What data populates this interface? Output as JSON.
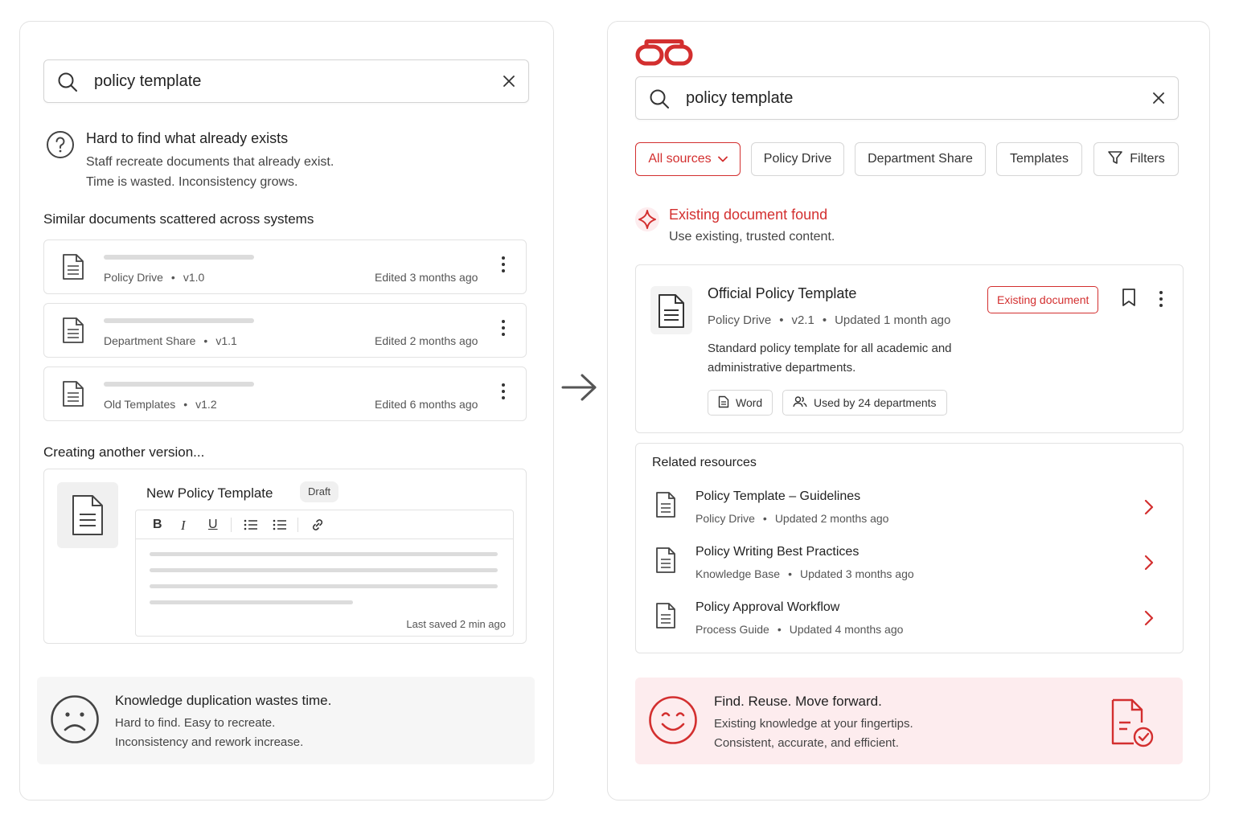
{
  "left": {
    "search": {
      "query": "policy template"
    },
    "problem": {
      "title": "Hard to find what already exists",
      "line1": "Staff recreate documents that already exist.",
      "line2": "Time is wasted. Inconsistency grows."
    },
    "scattered_heading": "Similar documents scattered across systems",
    "docs": [
      {
        "source": "Policy Drive",
        "version": "v1.0",
        "edited": "Edited 3 months ago"
      },
      {
        "source": "Department Share",
        "version": "v1.1",
        "edited": "Edited 2 months ago"
      },
      {
        "source": "Old Templates",
        "version": "v1.2",
        "edited": "Edited 6 months ago"
      }
    ],
    "creating_heading": "Creating another version...",
    "editor": {
      "title": "New Policy Template",
      "badge": "Draft",
      "toolbar": {
        "bold": "B",
        "italic": "I",
        "underline": "U"
      },
      "saved": "Last saved 2 min ago"
    },
    "footer": {
      "title": "Knowledge duplication wastes time.",
      "line1": "Hard to find. Easy to recreate.",
      "line2": "Inconsistency and rework increase."
    }
  },
  "right": {
    "search": {
      "query": "policy template"
    },
    "filters": {
      "all_sources": "All sources",
      "chips": [
        "Policy Drive",
        "Department Share",
        "Templates"
      ],
      "filters_label": "Filters"
    },
    "found": {
      "title": "Existing document found",
      "subtitle": "Use existing, trusted content."
    },
    "result": {
      "title": "Official Policy Template",
      "source": "Policy Drive",
      "version": "v2.1",
      "updated": "Updated 1 month ago",
      "badge": "Existing document",
      "desc1": "Standard policy template for all academic and",
      "desc2": "administrative departments.",
      "format": "Word",
      "usage": "Used by 24 departments"
    },
    "related": {
      "heading": "Related resources",
      "items": [
        {
          "title": "Policy Template – Guidelines",
          "source": "Policy Drive",
          "updated": "Updated 2 months ago"
        },
        {
          "title": "Policy Writing Best Practices",
          "source": "Knowledge Base",
          "updated": "Updated 3 months ago"
        },
        {
          "title": "Policy Approval Workflow",
          "source": "Process Guide",
          "updated": "Updated 4 months ago"
        }
      ]
    },
    "footer": {
      "title": "Find. Reuse. Move forward.",
      "line1": "Existing knowledge at your fingertips.",
      "line2": "Consistent, accurate, and efficient."
    }
  },
  "colors": {
    "accent": "#d32f2f",
    "accent_bg": "#fdecee",
    "neutral_bg": "#f6f6f6"
  }
}
